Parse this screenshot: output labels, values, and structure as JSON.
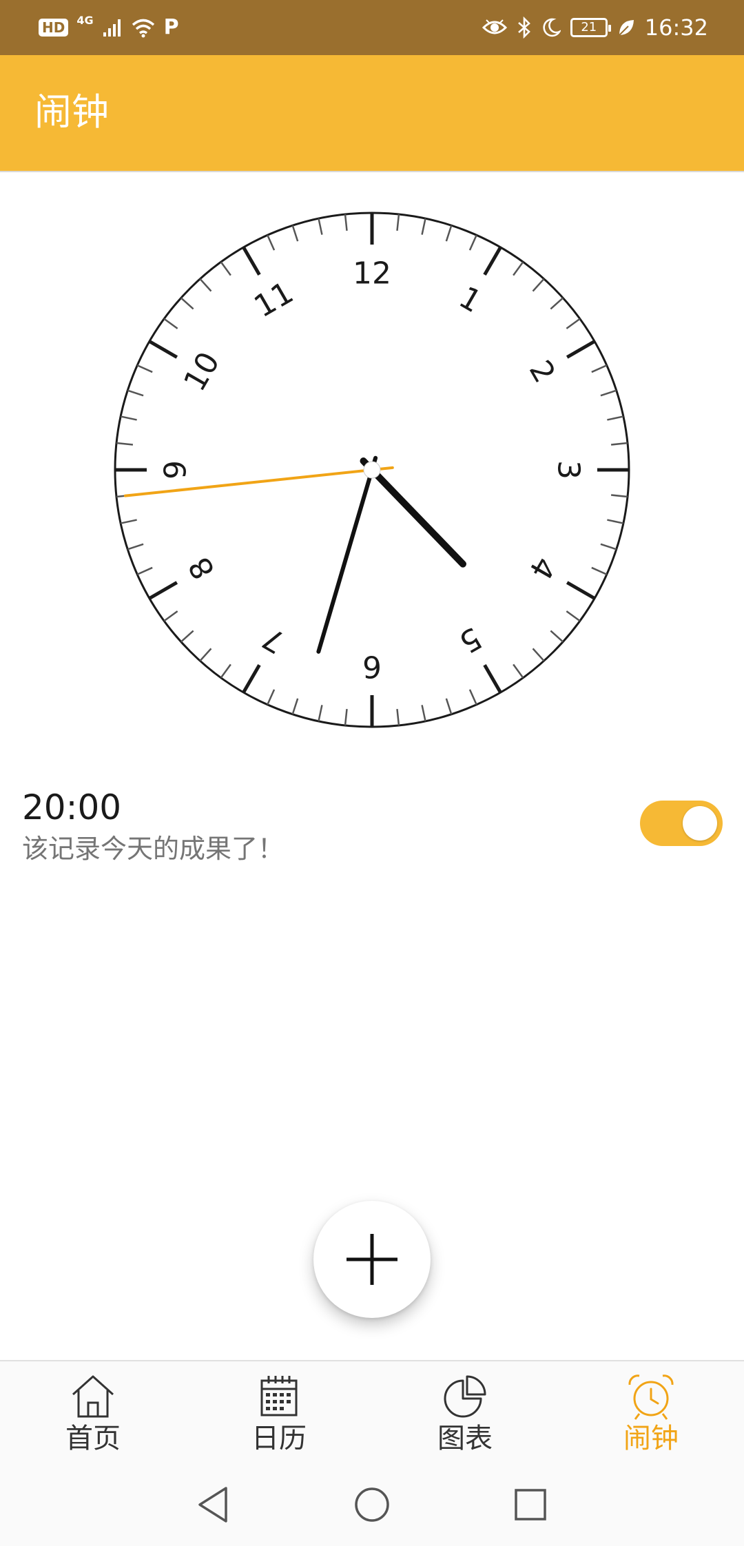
{
  "status_bar": {
    "left": {
      "hd": "HD",
      "network": "4G",
      "p_label": "P"
    },
    "battery": "21",
    "time": "16:32"
  },
  "app_bar": {
    "title": "闹钟"
  },
  "clock": {
    "numerals": [
      "12",
      "1",
      "2",
      "3",
      "4",
      "5",
      "6",
      "7",
      "8",
      "9",
      "10",
      "11"
    ],
    "displayed_time": {
      "hour": 4,
      "minute": 32,
      "second": 44
    },
    "second_hand_color": "#f1a416"
  },
  "alarm": {
    "time": "20:00",
    "label": "该记录今天的成果了！",
    "enabled": true
  },
  "fab": {
    "icon": "plus-icon"
  },
  "bottom_nav": {
    "items": [
      {
        "label": "首页",
        "icon": "home-icon",
        "active": false
      },
      {
        "label": "日历",
        "icon": "calendar-icon",
        "active": false
      },
      {
        "label": "图表",
        "icon": "pie-chart-icon",
        "active": false
      },
      {
        "label": "闹钟",
        "icon": "alarm-clock-icon",
        "active": true
      }
    ]
  },
  "system_nav": {
    "items": [
      "back-icon",
      "home-circle-icon",
      "recents-icon"
    ]
  },
  "colors": {
    "status_bar": "#9a6f2e",
    "app_bar": "#f6b935",
    "accent": "#f1a416",
    "toggle": "#f6b935"
  }
}
